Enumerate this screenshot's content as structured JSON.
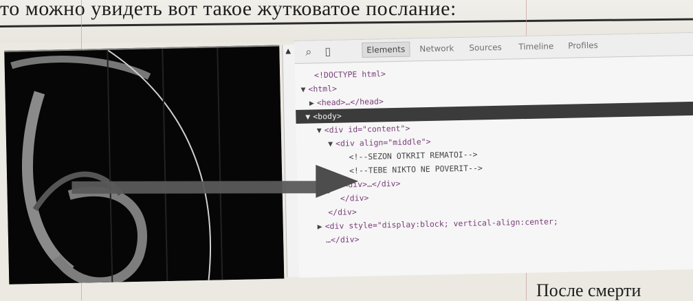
{
  "book": {
    "top_text": "то можно увидеть вот такое жутковатое послание:",
    "bottom_text": "После смерти"
  },
  "devtools": {
    "toolbar": {
      "search_icon": "magnifier-icon",
      "device_icon": "mobile-device-icon",
      "tabs": [
        "Elements",
        "Network",
        "Sources",
        "Timeline",
        "Profiles"
      ]
    },
    "lines": [
      {
        "text": "<!DOCTYPE html>",
        "expand": ""
      },
      {
        "text": "<html>",
        "expand": "▼"
      },
      {
        "text": "<head>…</head>",
        "expand": "▶"
      },
      {
        "text": "<body>",
        "expand": "▼"
      },
      {
        "text": "<div id=\"content\">",
        "expand": "▼"
      },
      {
        "text": "<div align=\"middle\">",
        "expand": "▼"
      },
      {
        "text": "<!--SEZON OTKRIT REMATOI-->",
        "expand": ""
      },
      {
        "text": "<!--TEBE NIKTO NE POVERIT-->",
        "expand": ""
      },
      {
        "text": "<div>…</div>",
        "expand": "▶"
      },
      {
        "text": "</div>",
        "expand": ""
      },
      {
        "text": "</div>",
        "expand": ""
      },
      {
        "text": "<div style=\"display:block; vertical-align:center;",
        "expand": "▶"
      },
      {
        "text": "…</div>",
        "expand": ""
      }
    ]
  },
  "colors": {
    "selection": "#3b3b3b",
    "arrow": "#4d4d4d"
  }
}
